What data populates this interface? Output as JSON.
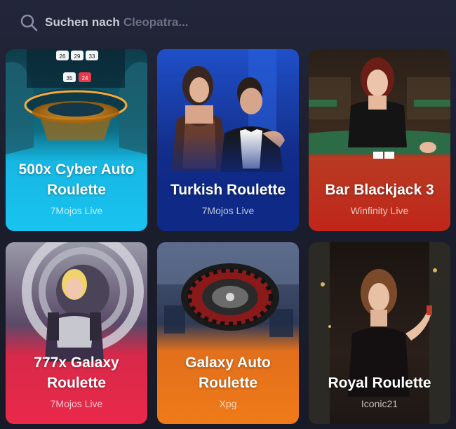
{
  "search": {
    "prefix": "Suchen nach",
    "hint": "Cleopatra..."
  },
  "cards": [
    {
      "title_line1": "500x Cyber Auto",
      "title_line2": "Roulette",
      "provider": "7Mojos Live",
      "color": "#19c3f0"
    },
    {
      "title_line1": "",
      "title_line2": "Turkish Roulette",
      "provider": "7Mojos Live",
      "color": "#123aa8"
    },
    {
      "title_line1": "",
      "title_line2": "Bar Blackjack 3",
      "provider": "Winfinity Live",
      "color": "#c0261a"
    },
    {
      "title_line1": "777x Galaxy",
      "title_line2": "Roulette",
      "provider": "7Mojos Live",
      "color": "#e9294a"
    },
    {
      "title_line1": "Galaxy Auto",
      "title_line2": "Roulette",
      "provider": "Xpg",
      "color": "#f07a18"
    },
    {
      "title_line1": "",
      "title_line2": "Royal Roulette",
      "provider": "Iconic21",
      "color": "#2a1f1a"
    }
  ],
  "roulette_numbers": [
    "26",
    "29",
    "33",
    "35",
    "24"
  ]
}
